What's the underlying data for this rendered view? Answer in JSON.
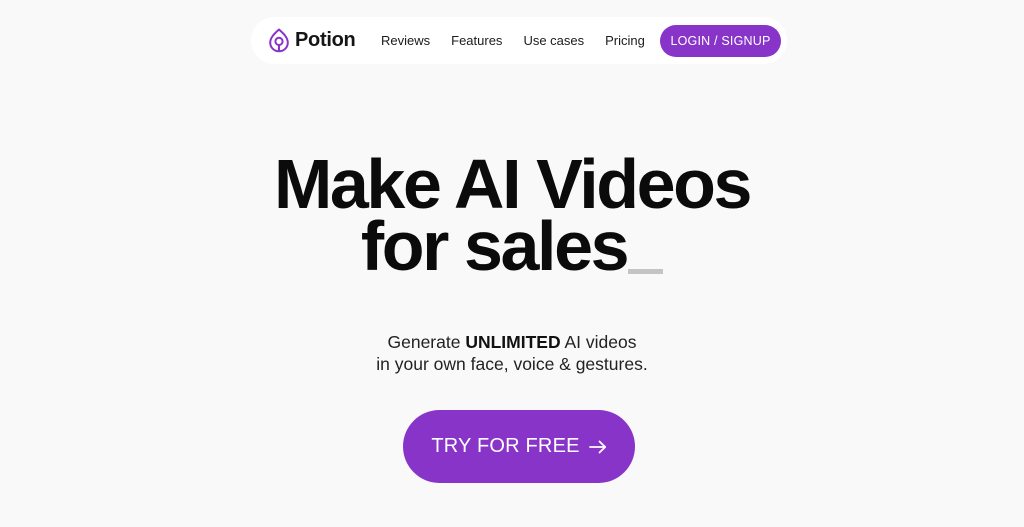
{
  "nav": {
    "brand": {
      "name": "Potion",
      "icon": "potion-logo-icon"
    },
    "links": [
      {
        "label": "Reviews"
      },
      {
        "label": "Features"
      },
      {
        "label": "Use cases"
      },
      {
        "label": "Pricing"
      }
    ],
    "login_label": "LOGIN / SIGNUP"
  },
  "hero": {
    "title_line1": "Make AI Videos",
    "title_line2": "for sales",
    "subtitle_prefix": "Generate ",
    "subtitle_bold": "UNLIMITED",
    "subtitle_suffix": " AI videos",
    "subtitle_line2": "in your own face, voice & gestures.",
    "cta_label": "TRY FOR FREE",
    "cta_icon": "arrow-right-icon"
  },
  "colors": {
    "accent": "#8834c9",
    "background": "#f9f9f9",
    "nav_background": "#ffffff",
    "text": "#0b0b0b",
    "caret": "#c4c4c4"
  }
}
